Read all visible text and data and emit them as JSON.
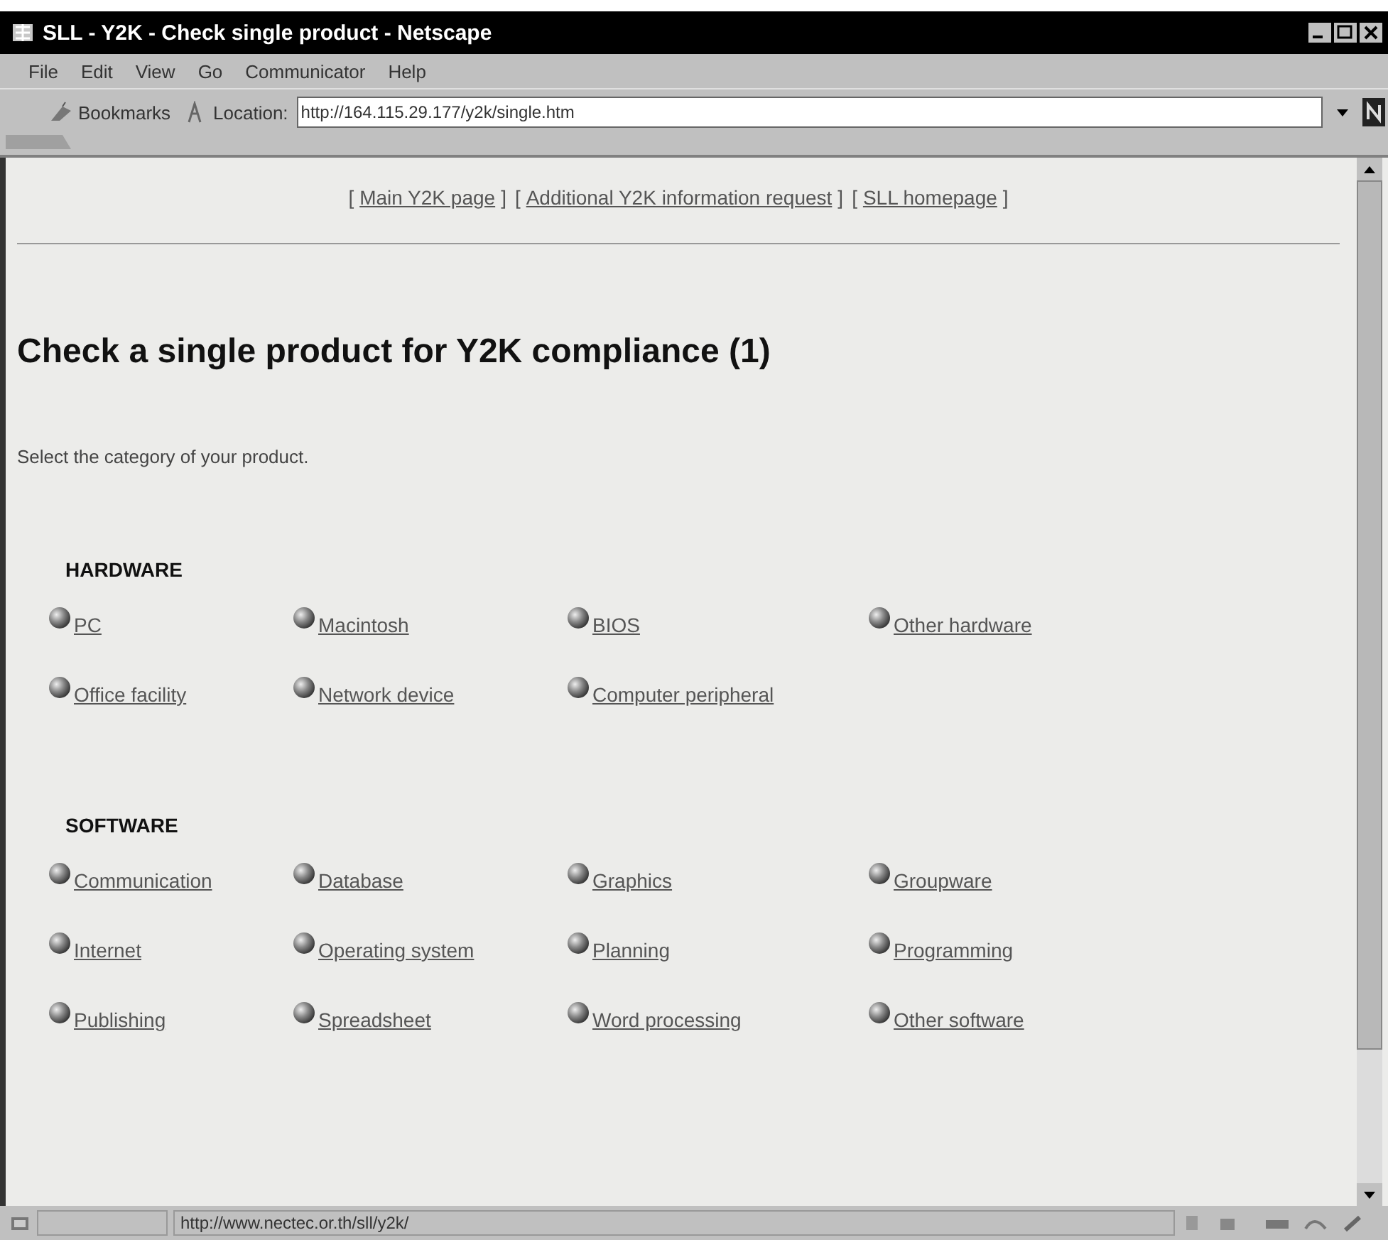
{
  "window": {
    "title": "SLL - Y2K - Check single product - Netscape"
  },
  "menu": [
    "File",
    "Edit",
    "View",
    "Go",
    "Communicator",
    "Help"
  ],
  "toolbar": {
    "bookmarks": "Bookmarks",
    "location_label": "Location:",
    "url": "http://164.115.29.177/y2k/single.htm"
  },
  "nav_links": [
    {
      "open": "[",
      "label": "Main Y2K page",
      "close": "]"
    },
    {
      "open": "[",
      "label": "Additional Y2K information request",
      "close": "]"
    },
    {
      "open": "[",
      "label": "SLL homepage",
      "close": "]"
    }
  ],
  "heading": "Check a single product for Y2K compliance (1)",
  "instruction": "Select the category of your product.",
  "sections": [
    {
      "title": "HARDWARE",
      "links": [
        "PC",
        "Macintosh",
        "BIOS",
        "Other hardware",
        "Office facility",
        "Network device",
        "Computer peripheral"
      ]
    },
    {
      "title": "SOFTWARE",
      "links": [
        "Communication",
        "Database",
        "Graphics",
        "Groupware",
        "Internet",
        "Operating system",
        "Planning",
        "Programming",
        "Publishing",
        "Spreadsheet",
        "Word processing",
        "Other software"
      ]
    }
  ],
  "status_bar": {
    "url": "http://www.nectec.or.th/sll/y2k/"
  }
}
